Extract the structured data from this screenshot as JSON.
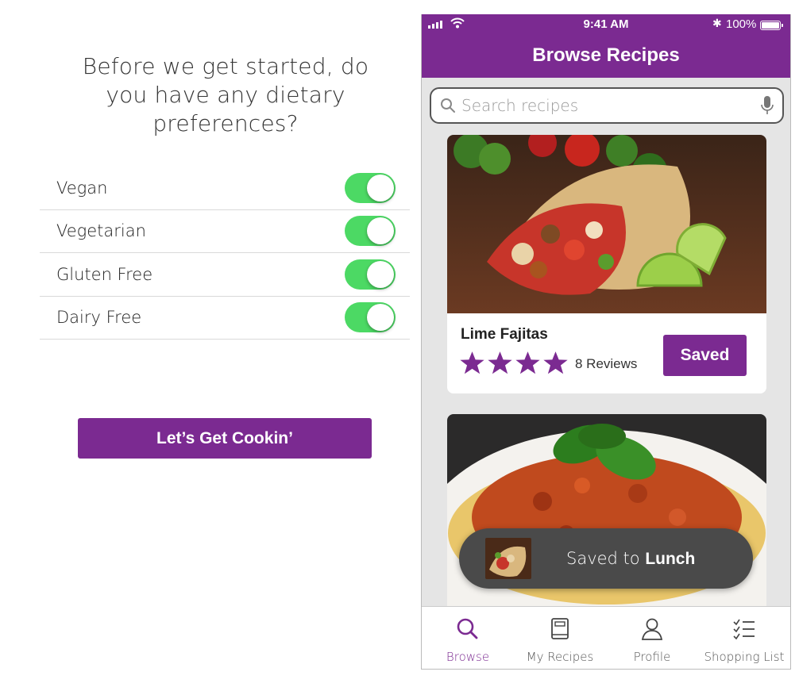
{
  "onboarding": {
    "question": "Before we get started, do you have any dietary preferences?",
    "preferences": [
      {
        "label": "Vegan",
        "enabled": true
      },
      {
        "label": "Vegetarian",
        "enabled": true
      },
      {
        "label": "Gluten Free",
        "enabled": true
      },
      {
        "label": "Dairy Free",
        "enabled": true
      }
    ],
    "cta_label": "Let’s Get Cookin’"
  },
  "phone": {
    "status_bar": {
      "time": "9:41 AM",
      "battery": "100%"
    },
    "title": "Browse Recipes",
    "search": {
      "placeholder": "Search recipes",
      "value": ""
    },
    "recipes": [
      {
        "name": "Lime Fajitas",
        "rating": 4,
        "reviews": "8 Reviews",
        "button_label": "Saved"
      }
    ],
    "toast": {
      "prefix": "Saved to ",
      "collection": "Lunch"
    },
    "tabs": [
      {
        "label": "Browse",
        "icon": "search-icon",
        "active": true
      },
      {
        "label": "My Recipes",
        "icon": "book-icon",
        "active": false
      },
      {
        "label": "Profile",
        "icon": "person-icon",
        "active": false
      },
      {
        "label": "Shopping List",
        "icon": "checklist-icon",
        "active": false
      }
    ]
  },
  "colors": {
    "brand_purple": "#7b2a91",
    "toggle_on": "#4cd964",
    "toast_bg": "#4a4a4a"
  }
}
